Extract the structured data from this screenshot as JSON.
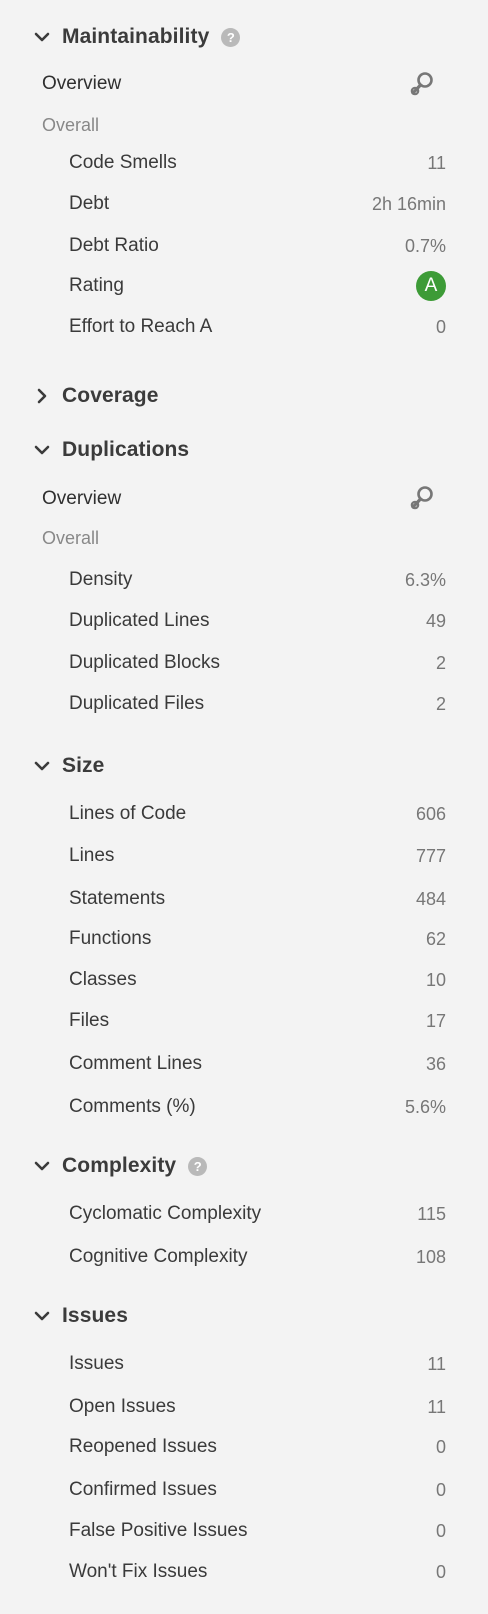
{
  "maintainability": {
    "title": "Maintainability",
    "help": "?",
    "overview_label": "Overview",
    "overall_label": "Overall",
    "rows": [
      {
        "label": "Code Smells",
        "value": "11"
      },
      {
        "label": "Debt",
        "value": "2h 16min"
      },
      {
        "label": "Debt Ratio",
        "value": "0.7%"
      },
      {
        "label": "Rating",
        "value": "A"
      },
      {
        "label": "Effort to Reach A",
        "value": "0"
      }
    ],
    "rating_color": "#3d9b37"
  },
  "coverage": {
    "title": "Coverage"
  },
  "duplications": {
    "title": "Duplications",
    "overview_label": "Overview",
    "overall_label": "Overall",
    "rows": [
      {
        "label": "Density",
        "value": "6.3%"
      },
      {
        "label": "Duplicated Lines",
        "value": "49"
      },
      {
        "label": "Duplicated Blocks",
        "value": "2"
      },
      {
        "label": "Duplicated Files",
        "value": "2"
      }
    ]
  },
  "size": {
    "title": "Size",
    "rows": [
      {
        "label": "Lines of Code",
        "value": "606"
      },
      {
        "label": "Lines",
        "value": "777"
      },
      {
        "label": "Statements",
        "value": "484"
      },
      {
        "label": "Functions",
        "value": "62"
      },
      {
        "label": "Classes",
        "value": "10"
      },
      {
        "label": "Files",
        "value": "17"
      },
      {
        "label": "Comment Lines",
        "value": "36"
      },
      {
        "label": "Comments (%)",
        "value": "5.6%"
      }
    ]
  },
  "complexity": {
    "title": "Complexity",
    "help": "?",
    "rows": [
      {
        "label": "Cyclomatic Complexity",
        "value": "115"
      },
      {
        "label": "Cognitive Complexity",
        "value": "108"
      }
    ]
  },
  "issues": {
    "title": "Issues",
    "rows": [
      {
        "label": "Issues",
        "value": "11"
      },
      {
        "label": "Open Issues",
        "value": "11"
      },
      {
        "label": "Reopened Issues",
        "value": "0"
      },
      {
        "label": "Confirmed Issues",
        "value": "0"
      },
      {
        "label": "False Positive Issues",
        "value": "0"
      },
      {
        "label": "Won't Fix Issues",
        "value": "0"
      }
    ]
  },
  "icons": {
    "expanded": "chevron-down-icon",
    "collapsed": "chevron-right-icon",
    "overview": "magnifier-icon",
    "help": "help-icon"
  }
}
